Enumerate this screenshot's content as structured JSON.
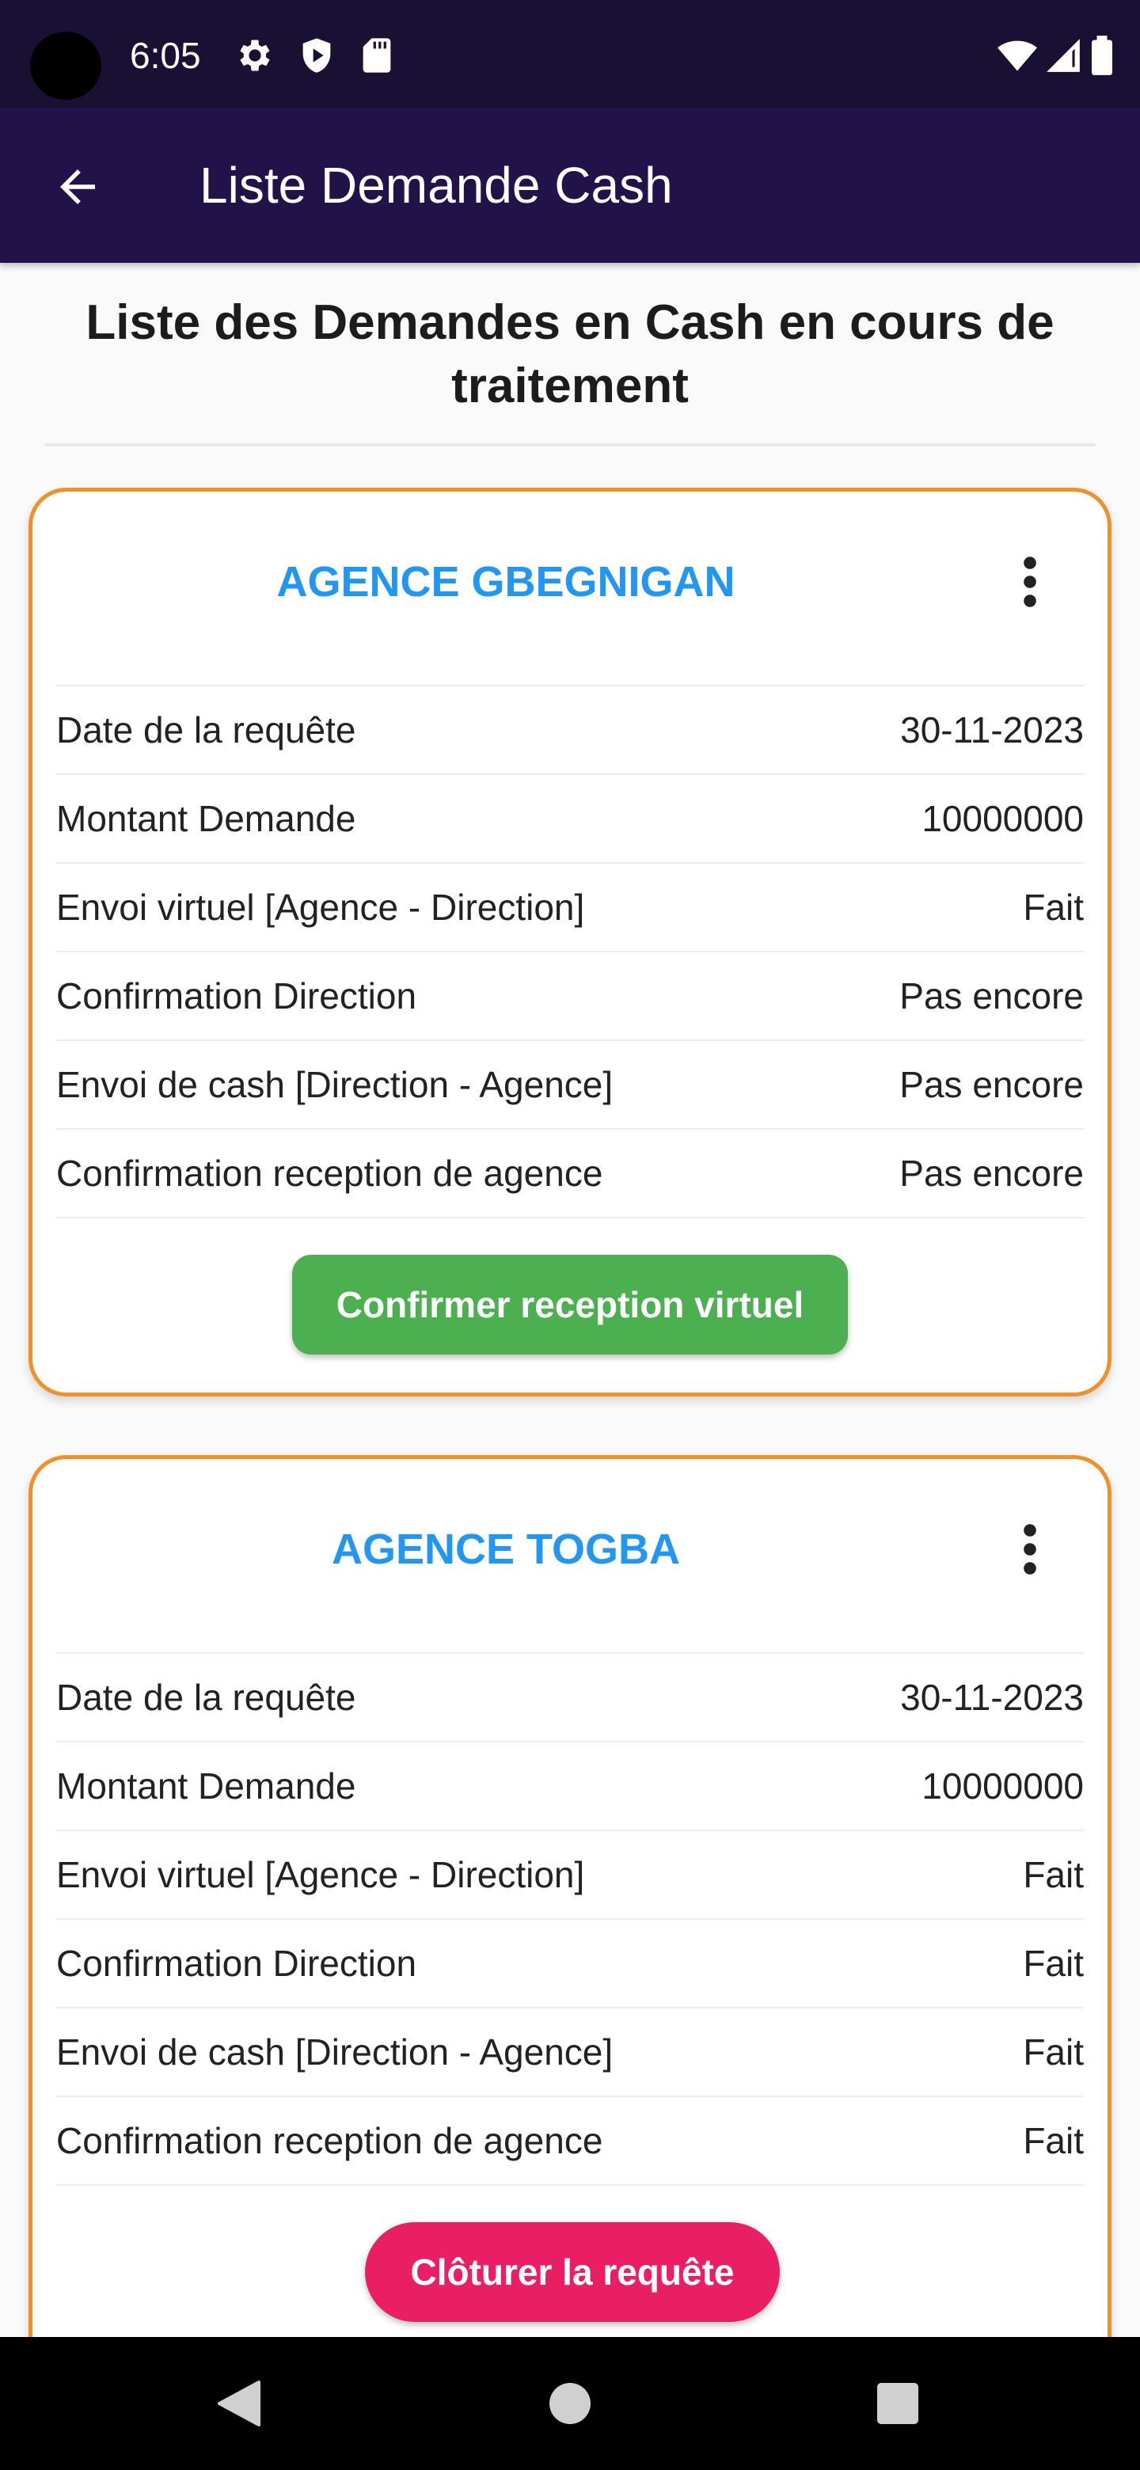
{
  "status_bar": {
    "time": "6:05",
    "icons_left": [
      "settings-icon",
      "shield-play-icon",
      "sd-card-icon"
    ],
    "icons_right": [
      "wifi-icon",
      "signal-icon",
      "battery-icon"
    ]
  },
  "app_bar": {
    "back_icon": "arrow-back-icon",
    "title": "Liste Demande Cash"
  },
  "page": {
    "heading": "Liste des Demandes en Cash en cours de traitement"
  },
  "cards": [
    {
      "agency": "AGENCE GBEGNIGAN",
      "menu_icon": "more-vertical-icon",
      "rows": [
        {
          "label": "Date de la requête",
          "value": "30-11-2023"
        },
        {
          "label": "Montant Demande",
          "value": "10000000"
        },
        {
          "label": "Envoi virtuel [Agence - Direction]",
          "value": "Fait"
        },
        {
          "label": "Confirmation Direction",
          "value": "Pas encore"
        },
        {
          "label": "Envoi de cash [Direction - Agence]",
          "value": "Pas encore"
        },
        {
          "label": "Confirmation reception de agence",
          "value": "Pas encore"
        }
      ],
      "action_label": "Confirmer reception virtuel",
      "action_color": "#4caf50"
    },
    {
      "agency": "AGENCE TOGBA",
      "menu_icon": "more-vertical-icon",
      "rows": [
        {
          "label": "Date de la requête",
          "value": "30-11-2023"
        },
        {
          "label": "Montant Demande",
          "value": "10000000"
        },
        {
          "label": "Envoi virtuel [Agence - Direction]",
          "value": "Fait"
        },
        {
          "label": "Confirmation Direction",
          "value": "Fait"
        },
        {
          "label": "Envoi de cash [Direction - Agence]",
          "value": "Fait"
        },
        {
          "label": "Confirmation reception de agence",
          "value": "Fait"
        }
      ],
      "action_label": "Clôturer la requête",
      "action_color": "#e91e63"
    }
  ],
  "colors": {
    "status_bar": "#1a1034",
    "app_bar": "#21124a",
    "card_border": "#f0902a",
    "agency_title": "#2196f3"
  },
  "nav_bar": {
    "icons": [
      "back-triangle-icon",
      "home-circle-icon",
      "recents-square-icon"
    ]
  }
}
